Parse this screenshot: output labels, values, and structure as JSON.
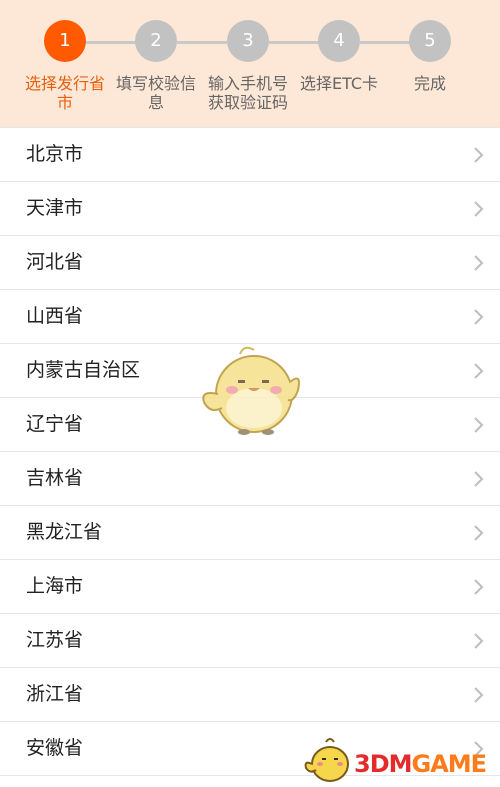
{
  "steps": [
    {
      "number": "1",
      "label": "选择发行省市",
      "active": true
    },
    {
      "number": "2",
      "label": "填写校验信息",
      "active": false
    },
    {
      "number": "3",
      "label": "输入手机号获取验证码",
      "active": false
    },
    {
      "number": "4",
      "label": "选择ETC卡",
      "active": false
    },
    {
      "number": "5",
      "label": "完成",
      "active": false
    }
  ],
  "provinces": [
    "北京市",
    "天津市",
    "河北省",
    "山西省",
    "内蒙古自治区",
    "辽宁省",
    "吉林省",
    "黑龙江省",
    "上海市",
    "江苏省",
    "浙江省",
    "安徽省"
  ],
  "watermark": {
    "number": "3DM",
    "rest": "GAME"
  },
  "colors": {
    "accent": "#ff5a00",
    "step_inactive": "#c2c2c2",
    "header_bg": "#fde7d6"
  }
}
